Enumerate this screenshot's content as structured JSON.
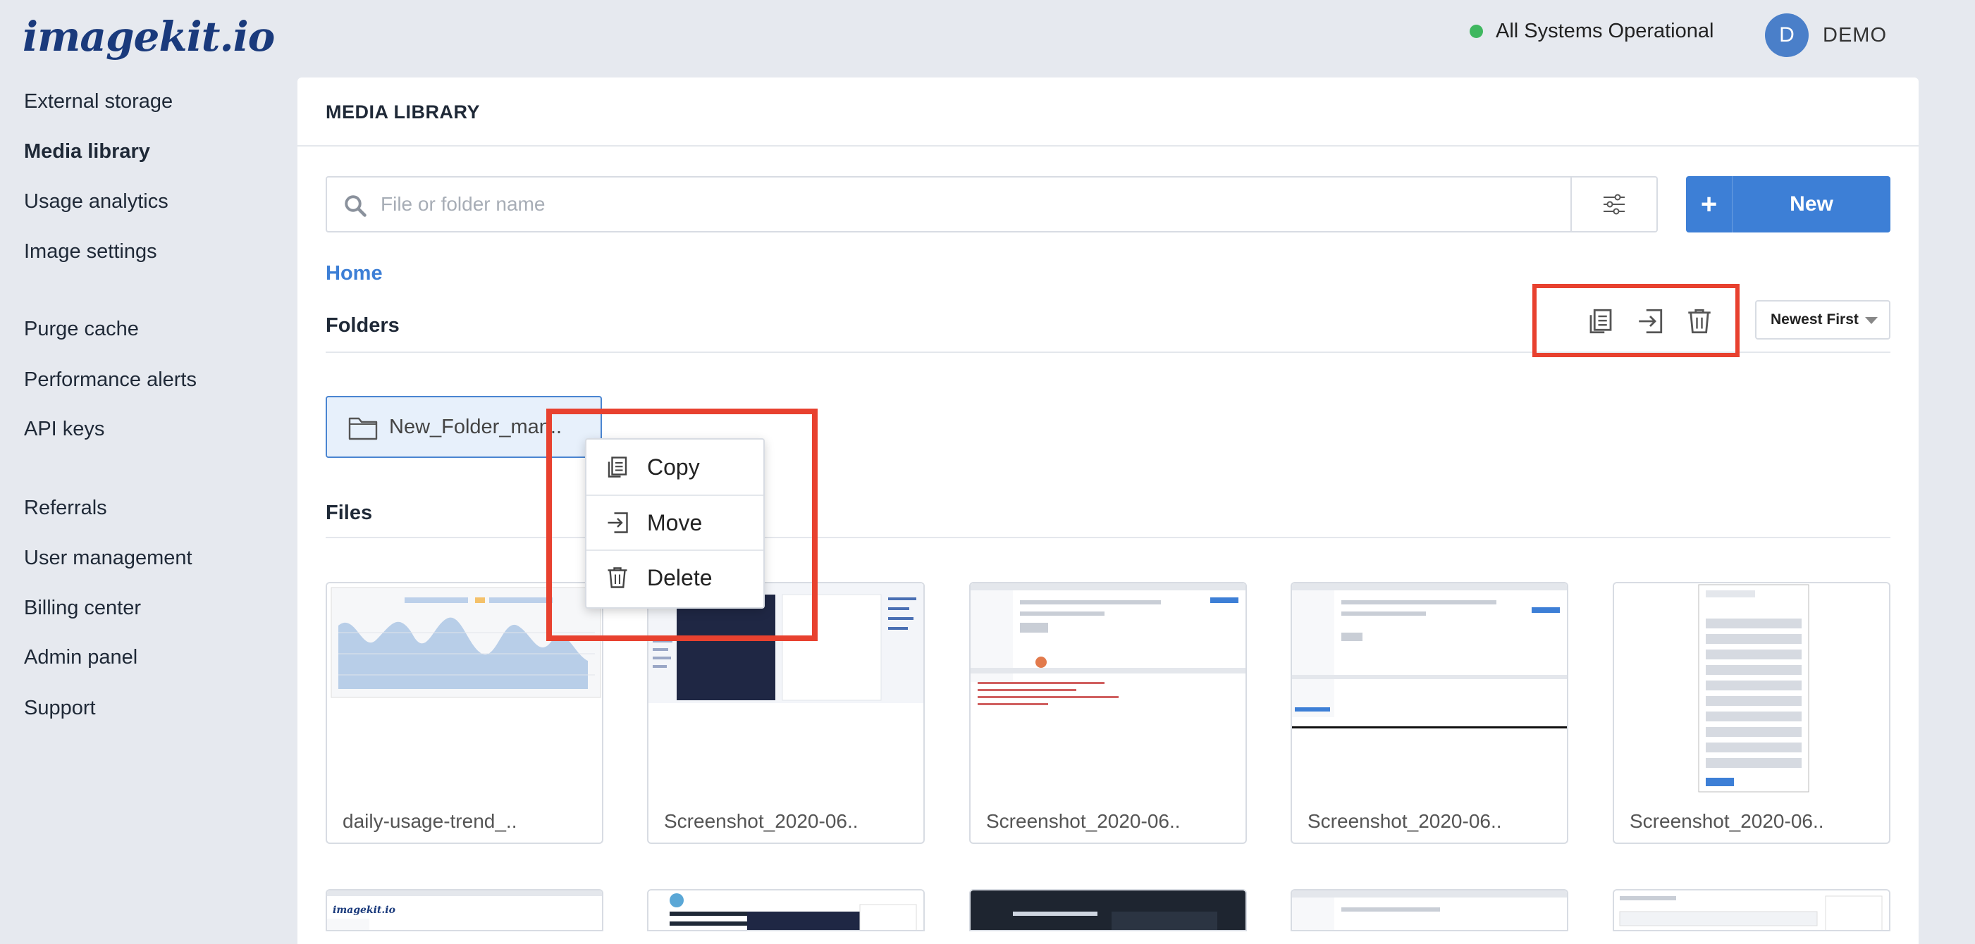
{
  "brand": {
    "logo_text": "imagekit.io"
  },
  "topbar": {
    "status_text": "All Systems Operational",
    "status_color": "#3fb75f",
    "avatar_initial": "D",
    "user_name": "DEMO"
  },
  "sidebar": {
    "items": [
      {
        "label": "External storage",
        "active": false
      },
      {
        "label": "Media library",
        "active": true
      },
      {
        "label": "Usage analytics",
        "active": false
      },
      {
        "label": "Image settings",
        "active": false
      },
      {
        "label": "Purge cache",
        "active": false
      },
      {
        "label": "Performance alerts",
        "active": false
      },
      {
        "label": "API keys",
        "active": false
      },
      {
        "label": "Referrals",
        "active": false
      },
      {
        "label": "User management",
        "active": false
      },
      {
        "label": "Billing center",
        "active": false
      },
      {
        "label": "Admin panel",
        "active": false
      },
      {
        "label": "Support",
        "active": false
      }
    ]
  },
  "main": {
    "title": "MEDIA LIBRARY",
    "search_placeholder": "File or folder name",
    "new_button_label": "New",
    "breadcrumb": "Home",
    "folders_title": "Folders",
    "sort_label": "Newest First",
    "folder": {
      "name": "New_Folder_man.."
    },
    "files_title": "Files",
    "files": [
      {
        "name": "daily-usage-trend_.."
      },
      {
        "name": "Screenshot_2020-06.."
      },
      {
        "name": "Screenshot_2020-06.."
      },
      {
        "name": "Screenshot_2020-06.."
      },
      {
        "name": "Screenshot_2020-06.."
      }
    ]
  },
  "context_menu": {
    "items": [
      {
        "label": "Copy",
        "icon": "copy-icon"
      },
      {
        "label": "Move",
        "icon": "move-icon"
      },
      {
        "label": "Delete",
        "icon": "trash-icon"
      }
    ]
  },
  "colors": {
    "accent": "#3d7fd6",
    "highlight": "#e8412f",
    "logo": "#1a3a7c"
  }
}
